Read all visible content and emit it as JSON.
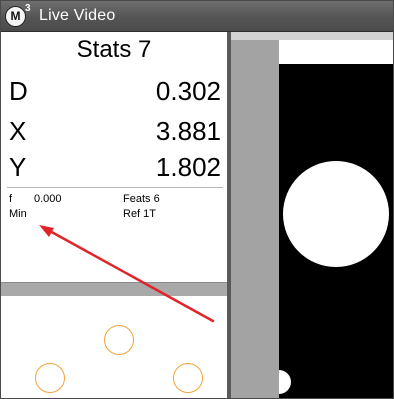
{
  "window": {
    "logo_letter": "M",
    "logo_superscript": "3",
    "title": "Live Video"
  },
  "stats": {
    "title": "Stats 7",
    "readouts": [
      {
        "label": "D",
        "value": "0.302"
      },
      {
        "label": "X",
        "value": "3.881"
      },
      {
        "label": "Y",
        "value": "1.802"
      }
    ],
    "info": {
      "f_label": "f",
      "f_value": "0.000",
      "feats": "Feats 6",
      "min": "Min",
      "ref": "Ref 1T"
    }
  },
  "colors": {
    "titlebar": "#555555",
    "feature_circle": "#f2a33a",
    "annotation_arrow": "#e0252a"
  },
  "icons": {
    "app_logo": "m3-logo-icon",
    "annotation": "red-arrow-icon"
  }
}
